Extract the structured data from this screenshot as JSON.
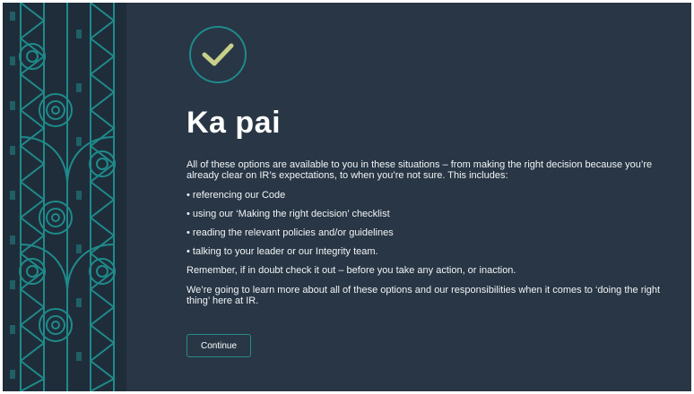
{
  "colors": {
    "background": "#283645",
    "pattern_background": "#1f2d3a",
    "pattern_teal": "#1f8a8a",
    "check_color": "#c8d08a",
    "accent": "#2a8b89"
  },
  "header": {
    "icon": "check-circle-icon",
    "title": "Ka pai"
  },
  "body": {
    "intro": "All of these options are available to you in these situations – from making the right decision because you’re already clear on IR’s expectations, to when you’re not sure. This includes:",
    "bullets": [
      "referencing our Code",
      "using our ‘Making the right decision’ checklist",
      "reading the relevant policies and/or guidelines",
      "talking to your leader or our Integrity team."
    ],
    "remember": "Remember, if in doubt check it out – before you take any action, or inaction.",
    "closing": "We’re going to learn more about all of these options and our responsibilities when it comes to ‘doing the right thing’ here at IR."
  },
  "actions": {
    "continue_label": "Continue"
  }
}
